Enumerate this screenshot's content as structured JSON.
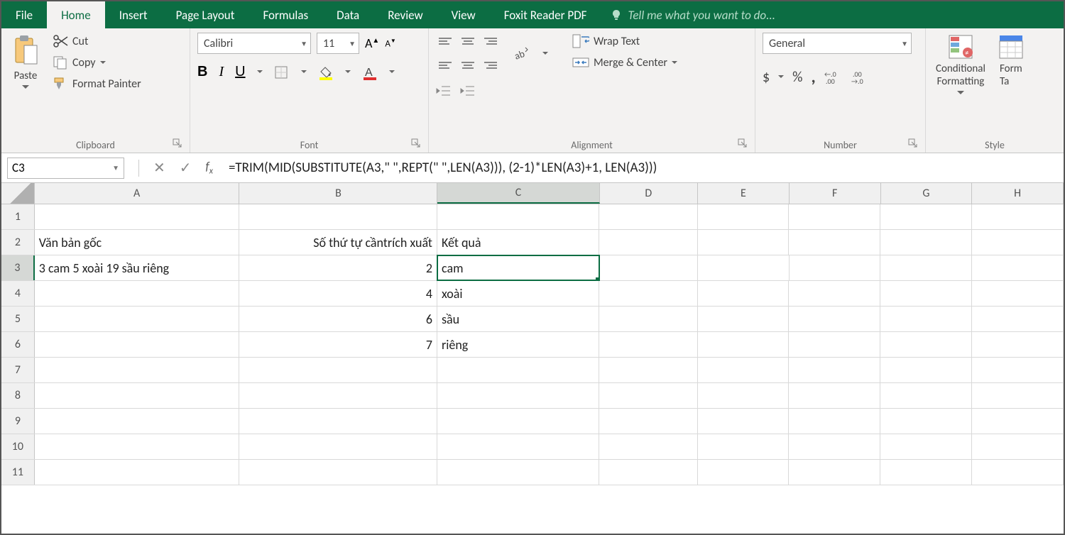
{
  "tabs": {
    "file": "File",
    "home": "Home",
    "insert": "Insert",
    "pagelayout": "Page Layout",
    "formulas": "Formulas",
    "data": "Data",
    "review": "Review",
    "view": "View",
    "foxit": "Foxit Reader PDF",
    "tellme": "Tell me what you want to do..."
  },
  "ribbon": {
    "clipboard": {
      "paste": "Paste",
      "cut": "Cut",
      "copy": "Copy",
      "painter": "Format Painter",
      "label": "Clipboard"
    },
    "font": {
      "name": "Calibri",
      "size": "11",
      "bold": "B",
      "italic": "I",
      "underline": "U",
      "label": "Font"
    },
    "alignment": {
      "wrap": "Wrap Text",
      "merge": "Merge & Center",
      "label": "Alignment"
    },
    "number": {
      "format": "General",
      "currency": "$",
      "percent": "%",
      "comma": ",",
      "incdec": "←.0\n.00",
      "decinc": ".00\n→.0",
      "label": "Number"
    },
    "styles": {
      "cond": "Conditional\nFormatting",
      "format_table": "Form\nTa",
      "label": "Style"
    }
  },
  "formula_bar": {
    "name": "C3",
    "formula": "=TRIM(MID(SUBSTITUTE(A3,\" \",REPT(\" \",LEN(A3))), (2-1)*LEN(A3)+1, LEN(A3)))"
  },
  "columns": [
    "A",
    "B",
    "C",
    "D",
    "E",
    "F",
    "G",
    "H"
  ],
  "row_numbers": [
    "1",
    "2",
    "3",
    "4",
    "5",
    "6",
    "7",
    "8",
    "9",
    "10",
    "11"
  ],
  "active_cell": "C3",
  "cells": {
    "A2": "Văn bản gốc",
    "B2": "Số thứ tự cầntrích xuất",
    "C2": "Kết quả",
    "A3": "3 cam 5 xoài 19 sầu riêng",
    "B3": "2",
    "C3": "cam",
    "B4": "4",
    "C4": "xoài",
    "B5": "6",
    "C5": "sầu",
    "B6": "7",
    "C6": "riêng"
  }
}
